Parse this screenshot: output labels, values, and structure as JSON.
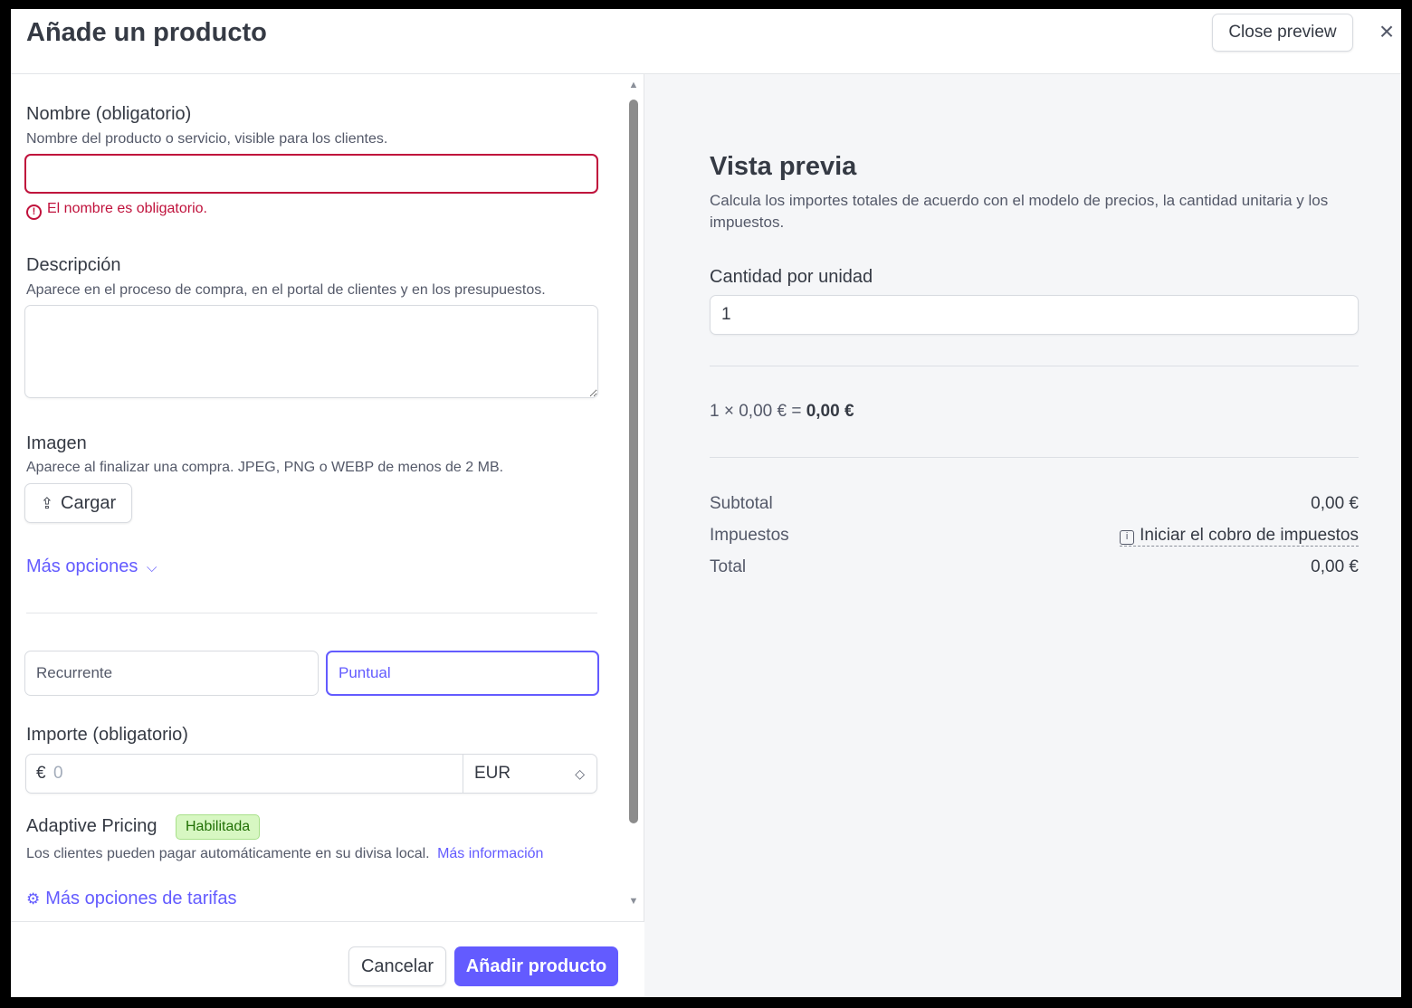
{
  "header": {
    "title": "Añade un producto",
    "close_preview_label": "Close preview",
    "close_icon": "×"
  },
  "form": {
    "name": {
      "label": "Nombre (obligatorio)",
      "help": "Nombre del producto o servicio, visible para los clientes.",
      "value": "",
      "error": "El nombre es obligatorio."
    },
    "description": {
      "label": "Descripción",
      "help": "Aparece en el proceso de compra, en el portal de clientes y en los presupuestos.",
      "value": ""
    },
    "image": {
      "label": "Imagen",
      "help": "Aparece al finalizar una compra. JPEG, PNG o WEBP de menos de 2 MB.",
      "upload_label": "Cargar"
    },
    "more_options_label": "Más opciones",
    "pricing_type": {
      "options": [
        "Recurrente",
        "Puntual"
      ],
      "selected": "Puntual"
    },
    "amount": {
      "label": "Importe (obligatorio)",
      "symbol": "€",
      "placeholder": "0",
      "currency": "EUR"
    },
    "adaptive_pricing": {
      "label": "Adaptive Pricing",
      "badge": "Habilitada",
      "help": "Los clientes pueden pagar automáticamente en su divisa local.",
      "link": "Más información"
    },
    "more_rate_options_label": "Más opciones de tarifas"
  },
  "footer": {
    "cancel_label": "Cancelar",
    "submit_label": "Añadir producto"
  },
  "preview": {
    "title": "Vista previa",
    "description": "Calcula los importes totales de acuerdo con el modelo de precios, la cantidad unitaria y los impuestos.",
    "quantity_label": "Cantidad por unidad",
    "quantity_value": "1",
    "formula_prefix": "1 × 0,00 € =",
    "formula_result": "0,00 €",
    "subtotal_label": "Subtotal",
    "subtotal_value": "0,00 €",
    "taxes_label": "Impuestos",
    "taxes_link": "Iniciar el cobro de impuestos",
    "total_label": "Total",
    "total_value": "0,00 €"
  },
  "colors": {
    "accent": "#635bff",
    "error": "#c0123c",
    "badge_bg": "#d7f7c2",
    "badge_text": "#217005"
  }
}
